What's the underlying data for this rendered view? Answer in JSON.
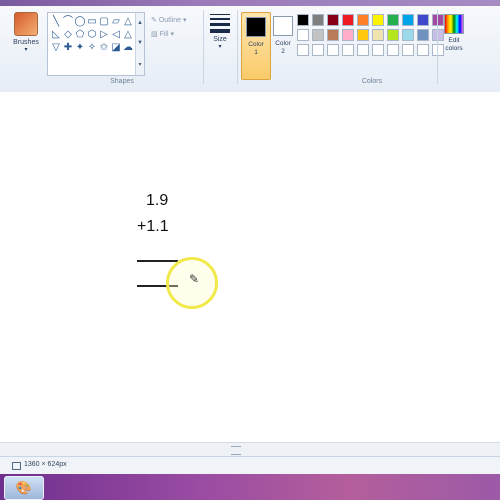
{
  "ribbon": {
    "brushes_label": "Brushes",
    "shapes_label": "Shapes",
    "outline_label": "Outline",
    "fill_label": "Fill",
    "size_label": "Size",
    "color1_label": "Color 1",
    "color2_label": "Color 2",
    "colors_label": "Colors",
    "edit_colors_label": "Edit colors",
    "color1_value": "#000000",
    "color2_value": "#ffffff",
    "shape_icons": [
      "╲",
      "⌒",
      "◯",
      "▭",
      "▢",
      "▱",
      "△",
      "◺",
      "◇",
      "⬠",
      "⬡",
      "▷",
      "◁",
      "△",
      "▽",
      "✚",
      "✦",
      "✧",
      "✩",
      "◪",
      "☁"
    ],
    "palette": [
      "#000000",
      "#7f7f7f",
      "#880015",
      "#ed1c24",
      "#ff7f27",
      "#fff200",
      "#22b14c",
      "#00a2e8",
      "#3f48cc",
      "#a349a4",
      "#ffffff",
      "#c3c3c3",
      "#b97a57",
      "#ffaec9",
      "#ffc90e",
      "#efe4b0",
      "#b5e61d",
      "#99d9ea",
      "#7092be",
      "#c8bfe7",
      "#ffffff",
      "#ffffff",
      "#ffffff",
      "#ffffff",
      "#ffffff",
      "#ffffff",
      "#ffffff",
      "#ffffff",
      "#ffffff",
      "#ffffff"
    ]
  },
  "canvas": {
    "line1": "1.9",
    "line2": "+1.1"
  },
  "status": {
    "dimensions": "1360 × 624px"
  }
}
